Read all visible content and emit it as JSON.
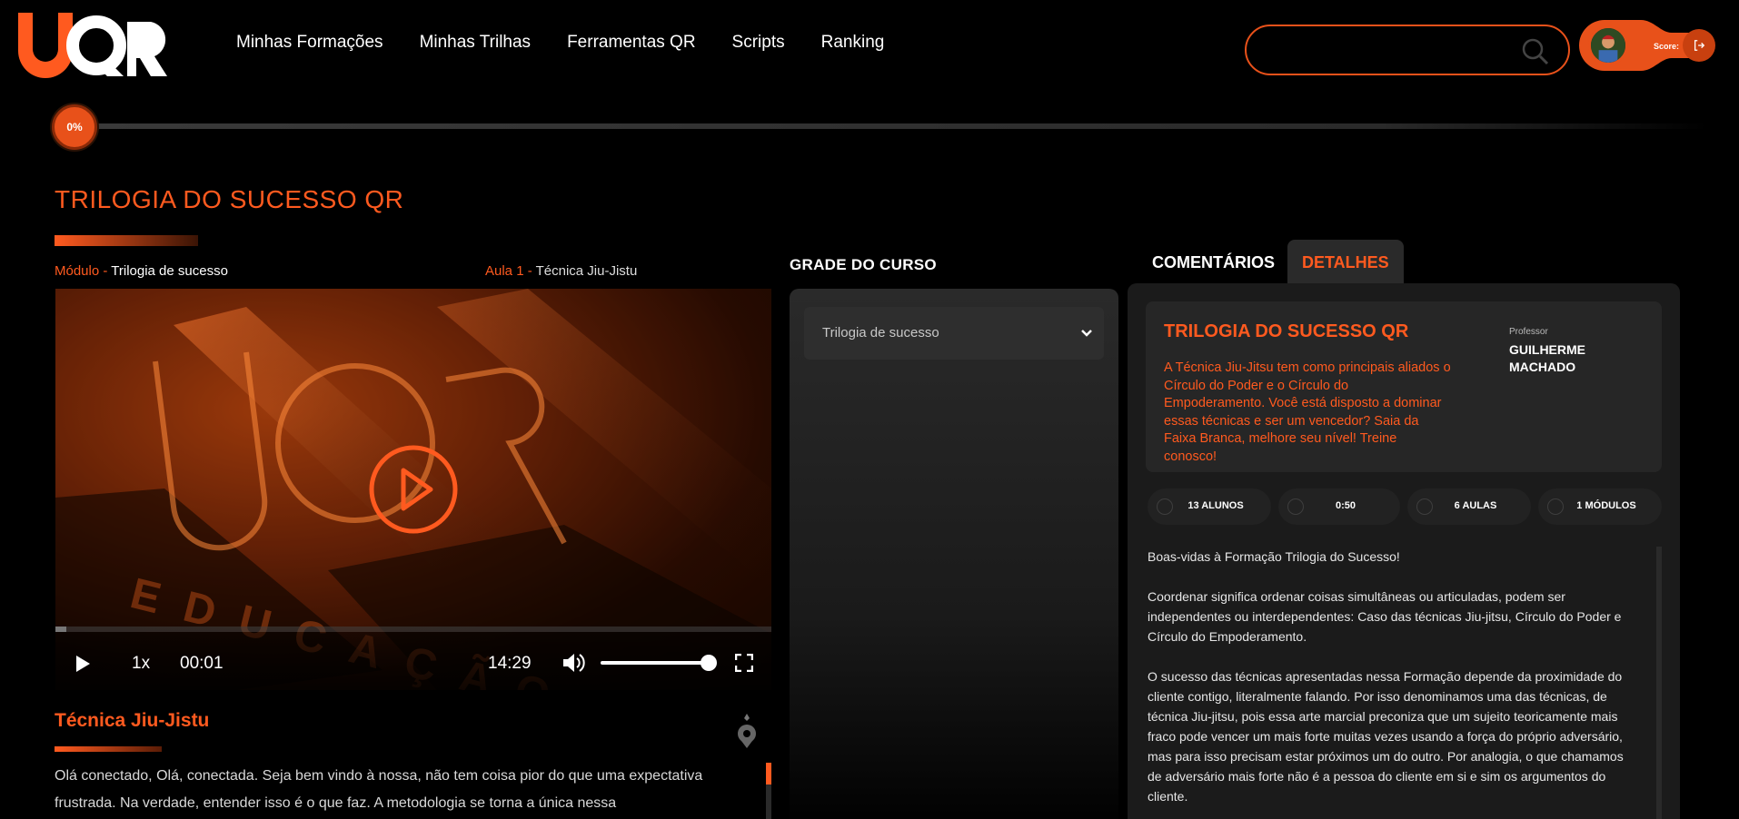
{
  "header": {
    "logo_text": "UQR",
    "nav": [
      "Minhas Formações",
      "Minhas Trilhas",
      "Ferramentas QR",
      "Scripts",
      "Ranking"
    ],
    "search_placeholder": "",
    "score_label": "Score:"
  },
  "progress": {
    "percent_label": "0%",
    "value": 0
  },
  "course": {
    "title": "TRILOGIA DO SUCESSO QR",
    "module_key": "Módulo - ",
    "module_val": "Trilogia de sucesso",
    "lesson_key": "Aula 1 - ",
    "lesson_val": "Técnica Jiu-Jistu"
  },
  "player": {
    "speed": "1x",
    "current_time": "00:01",
    "duration": "14:29",
    "volume": 1.0,
    "played_fraction": 0.015,
    "video_watermark": "EDUCAÇÃO"
  },
  "lesson": {
    "title": "Técnica Jiu-Jistu",
    "transcript": "Olá conectado,  Olá,  conectada.  Seja bem vindo à nossa,  não tem coisa pior do que uma expectativa frustrada.  Na verdade,  entender isso é o que faz.  A metodologia se torna a única nessa"
  },
  "grade": {
    "title": "GRADE DO CURSO",
    "selected_module": "Trilogia de sucesso"
  },
  "tabs": {
    "comments": "COMENTÁRIOS",
    "details": "DETALHES"
  },
  "details": {
    "card_title": "TRILOGIA DO SUCESSO QR",
    "card_desc": "A Técnica Jiu-Jitsu tem como principais aliados o Círculo do Poder e o Círculo do Empoderamento. Você está disposto a dominar essas técnicas e ser um vencedor? Saia da Faixa Branca, melhore seu nível! Treine conosco!",
    "professor_label": "Professor",
    "professor_name": "GUILHERME MACHADO",
    "stats": {
      "students": "13 ALUNOS",
      "duration": "0:50",
      "lessons": "6 AULAS",
      "modules": "1 MÓDULOS"
    },
    "paragraphs": [
      "Boas-vidas à Formação Trilogia do Sucesso!",
      "Coordenar significa ordenar coisas simultâneas ou articuladas, podem ser independentes ou interdependentes: Caso das técnicas Jiu-jitsu, Círculo do Poder e Círculo do Empoderamento.",
      "O sucesso das técnicas apresentadas nessa Formação depende da proximidade do cliente contigo, literalmente falando. Por isso denominamos uma das técnicas, de técnica Jiu-jitsu, pois essa arte marcial preconiza que um sujeito teoricamente mais fraco pode vencer um mais forte muitas vezes usando a força do próprio adversário, mas para isso precisam estar próximos um do outro. Por analogia, o que chamamos de adversário mais forte não é a pessoa do cliente em si e sim os argumentos do cliente."
    ]
  },
  "colors": {
    "accent": "#ff5a1f",
    "accent_dark": "#e8511a",
    "background": "#000000",
    "panel": "#1b1b1b"
  }
}
